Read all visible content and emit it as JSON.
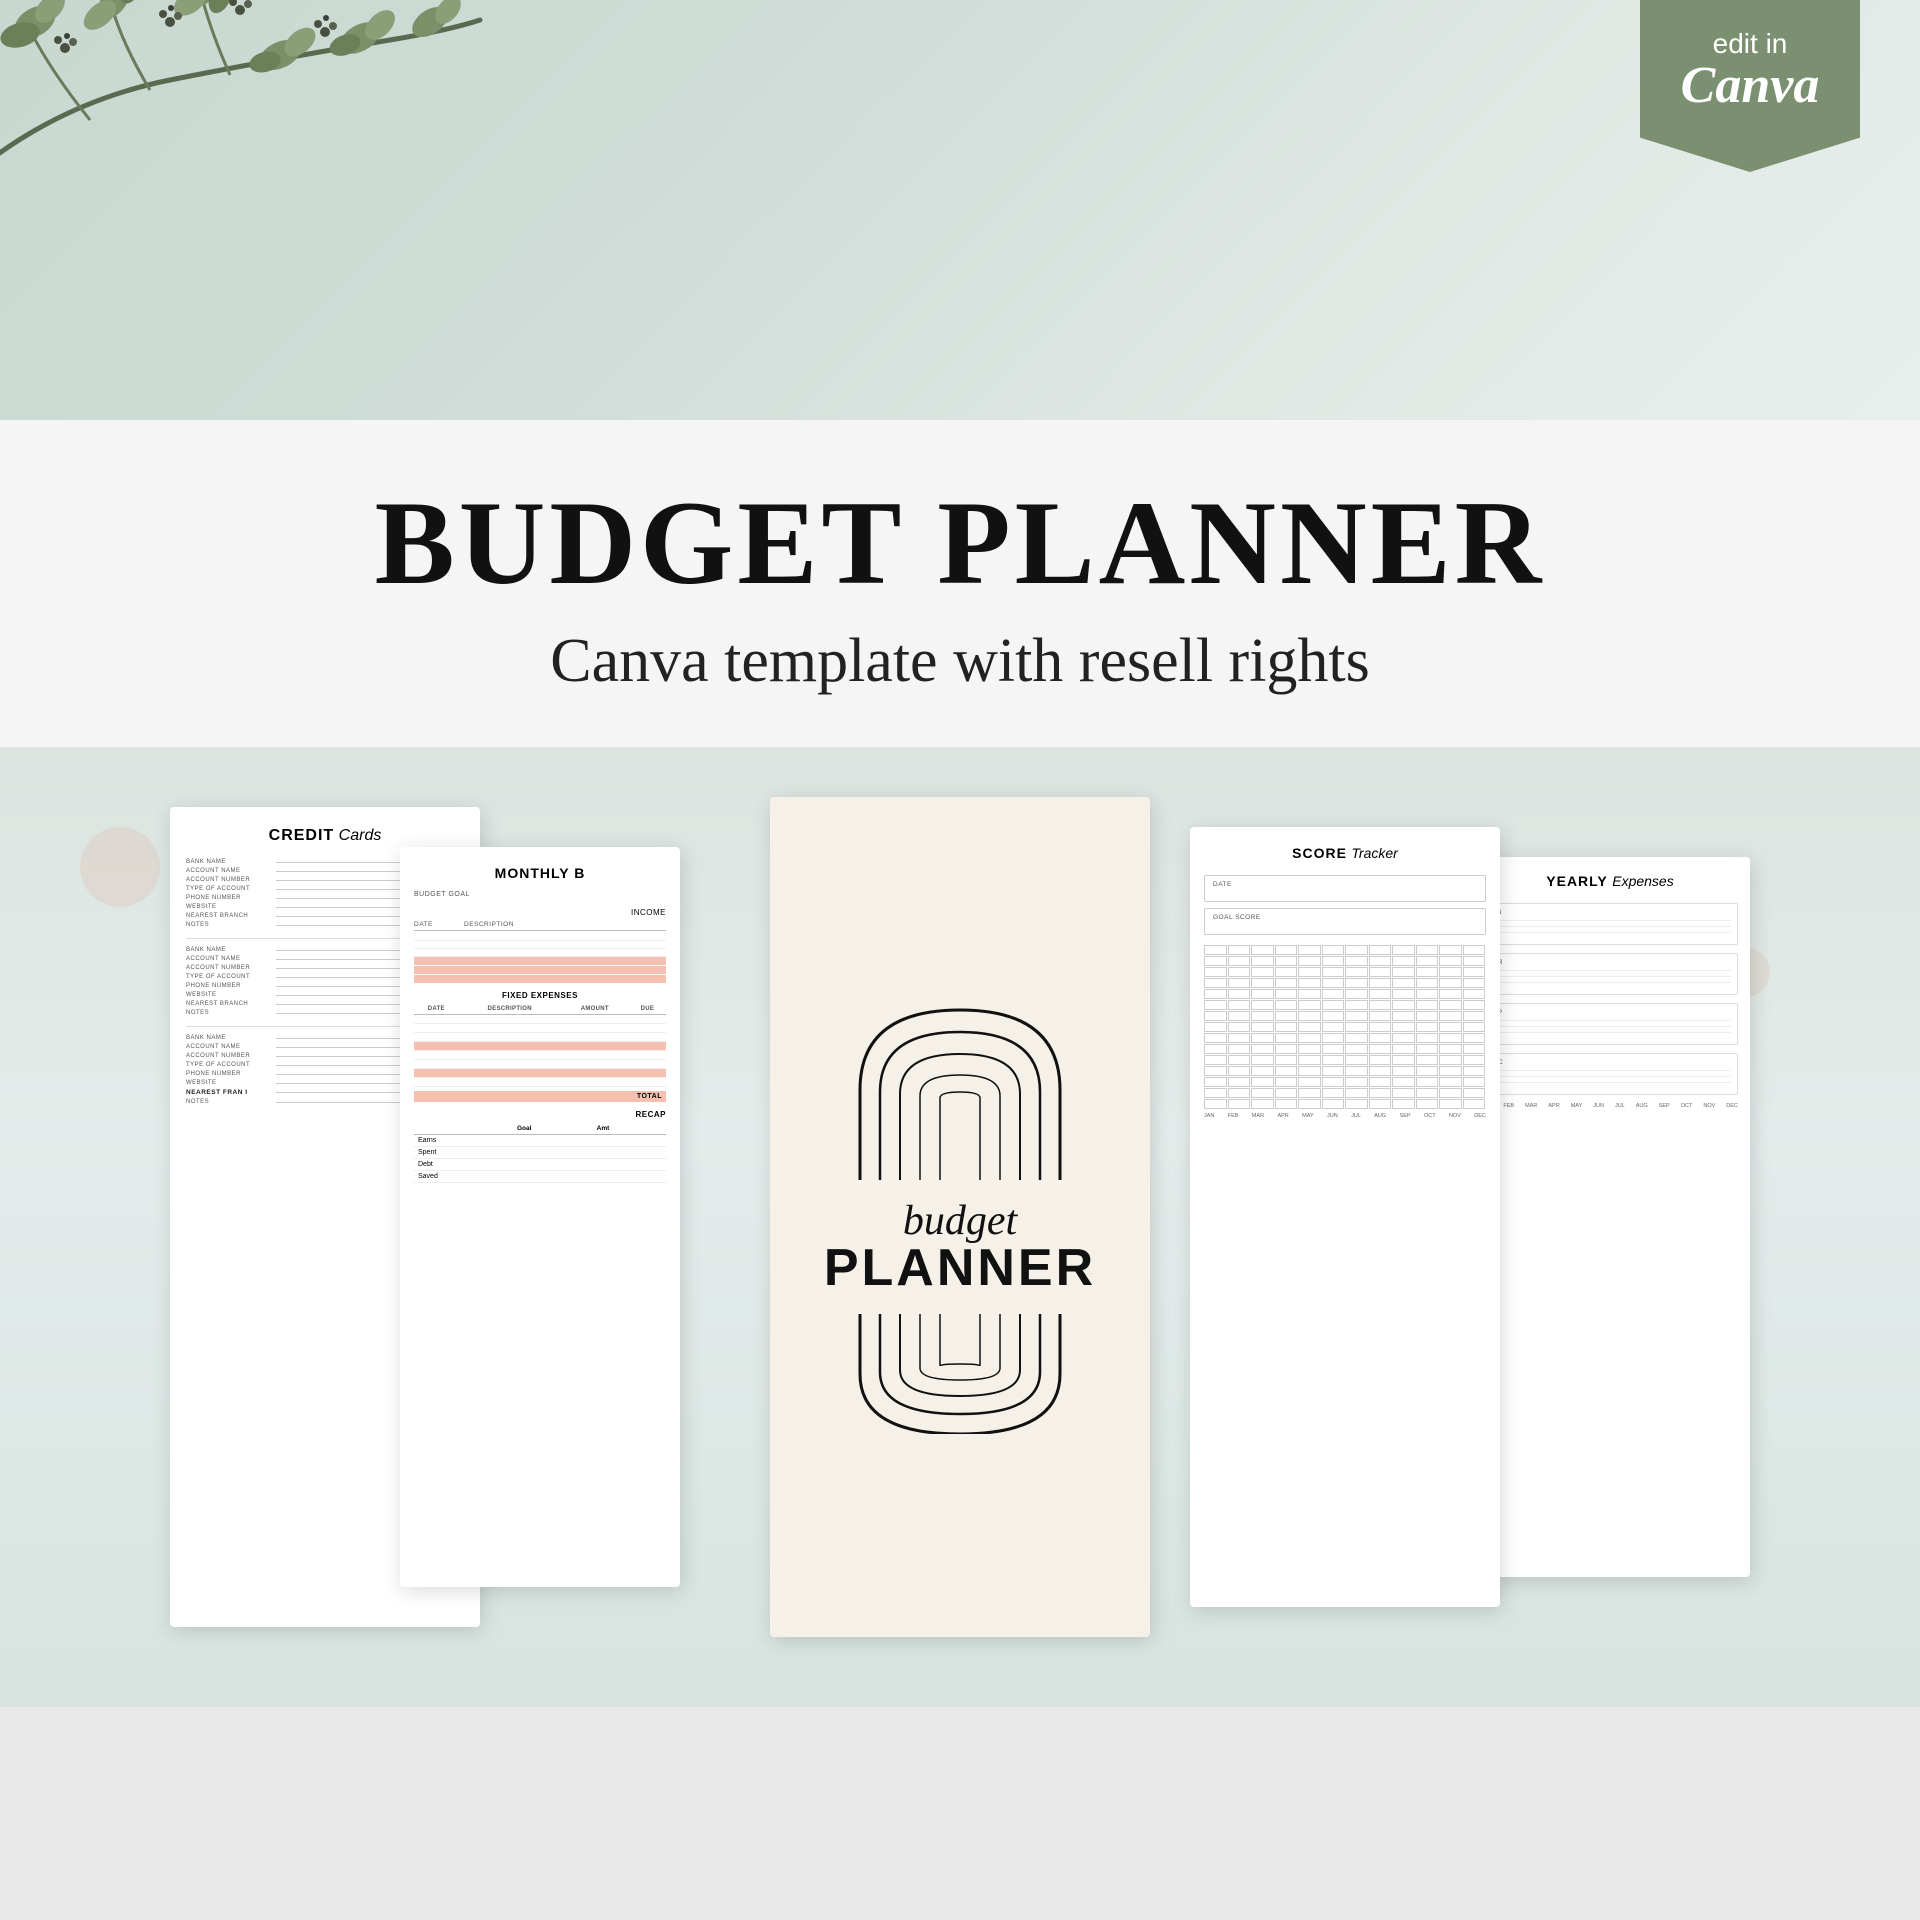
{
  "badge": {
    "edit_in": "edit in",
    "canva": "Canva"
  },
  "hero": {
    "main_title": "BUDGET PLANNER",
    "subtitle": "Canva template with resell rights"
  },
  "credit_card_page": {
    "title_bold": "CREDIT",
    "title_italic": "Cards",
    "bank_rows": [
      "BANK NAME",
      "ACCOUNT NAME",
      "ACCOUNT NUMBER",
      "TYPE OF ACCOUNT",
      "PHONE NUMBER",
      "WEBSITE",
      "NEAREST BRANCH",
      "NOTES"
    ]
  },
  "monthly_page": {
    "title": "MONTHLY B",
    "budget_goal": "BUDGET GOAL",
    "income_label": "INCOME",
    "date_col": "DATE",
    "desc_col": "DESCRIPTION",
    "section_fixed": "FIXED EXPENSES",
    "col_date": "Date",
    "col_desc": "Description",
    "col_amount": "Amount",
    "col_due": "Due",
    "total_label": "TOTAL",
    "recap_label": "RECAP",
    "recap_goal": "Goal",
    "recap_amt": "Amt",
    "recap_items": [
      "Earns",
      "Spent",
      "Debt",
      "Saved"
    ]
  },
  "cover_page": {
    "budget_text": "budget",
    "planner_text": "PLANNER"
  },
  "score_page": {
    "title_bold": "SCORE",
    "title_italic": "Tracker",
    "date_label": "DATE",
    "goal_score_label": "GOAL SCORE",
    "months": [
      "JAN",
      "FEB",
      "MAR",
      "APR",
      "MAY",
      "JUN",
      "JUL",
      "AUG",
      "SEP",
      "OCT",
      "NOV",
      "DEC"
    ]
  },
  "yearly_page": {
    "title_bold": "YEARLY",
    "title_italic": "Expenses",
    "sections": [
      "JAN",
      "FEB",
      "MAR",
      "APR",
      "MAY",
      "JUN",
      "JUL",
      "AUG",
      "SEP",
      "OCT",
      "NOV",
      "DEC"
    ]
  },
  "nearest_branch": "NEAREST FRAN I"
}
